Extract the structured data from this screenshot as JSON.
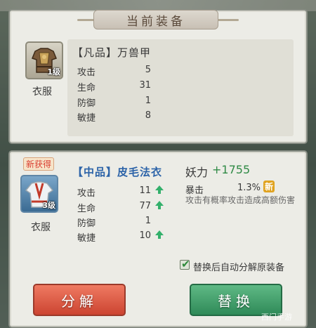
{
  "current": {
    "title": "当前装备",
    "item_name": "【凡品】万兽甲",
    "slot": "衣服",
    "level": "1级",
    "stats": [
      {
        "label": "攻击",
        "value": "5"
      },
      {
        "label": "生命",
        "value": "31"
      },
      {
        "label": "防御",
        "value": "1"
      },
      {
        "label": "敏捷",
        "value": "8"
      }
    ]
  },
  "new_item": {
    "badge": "新获得",
    "item_name": "【中品】皮毛法衣",
    "slot": "衣服",
    "level": "3级",
    "stats": [
      {
        "label": "攻击",
        "value": "11",
        "up": true
      },
      {
        "label": "生命",
        "value": "77",
        "up": true
      },
      {
        "label": "防御",
        "value": "1",
        "up": false
      },
      {
        "label": "敏捷",
        "value": "10",
        "up": true
      }
    ],
    "power_label": "妖力",
    "power_value": "+1755",
    "crit_label": "暴击",
    "crit_value": "1.3%",
    "new_tag": "新",
    "crit_desc": "攻击有概率攻击造成高额伤害"
  },
  "auto_decompose": {
    "checked": true,
    "label": "替换后自动分解原装备"
  },
  "buttons": {
    "decompose": "分解",
    "replace": "替换"
  },
  "watermark": "西门手游",
  "colors": {
    "up_arrow": "#33b06b",
    "power": "#2f8a45",
    "new_name": "#2c63a8"
  }
}
